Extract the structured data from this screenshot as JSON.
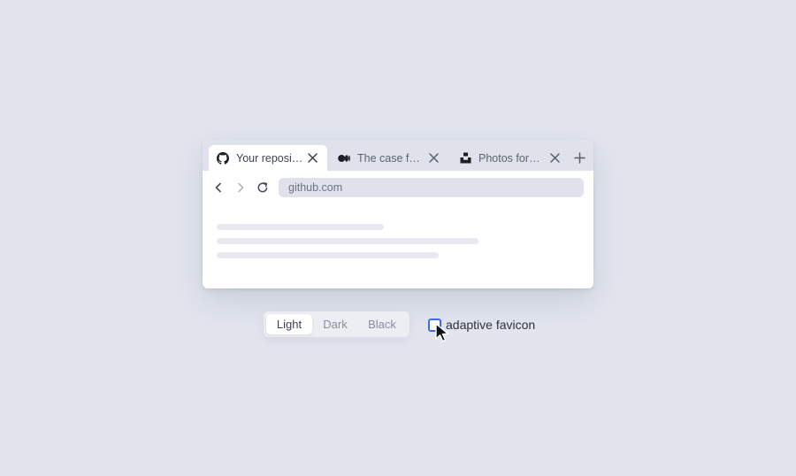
{
  "tabs": [
    {
      "title": "Your reposito...",
      "icon": "github-icon",
      "active": true
    },
    {
      "title": "The case for ...",
      "icon": "medium-icon",
      "active": false
    },
    {
      "title": "Photos for e...",
      "icon": "unsplash-icon",
      "active": false
    }
  ],
  "toolbar": {
    "url": "github.com"
  },
  "theme": {
    "options": [
      "Light",
      "Dark",
      "Black"
    ],
    "selected": "Light"
  },
  "adaptive_favicon": {
    "label": "adaptive favicon",
    "checked": false
  },
  "colors": {
    "background": "#e2e5ee",
    "tabstrip": "#dfe2ea",
    "checkbox_accent": "#3a6ee6"
  }
}
